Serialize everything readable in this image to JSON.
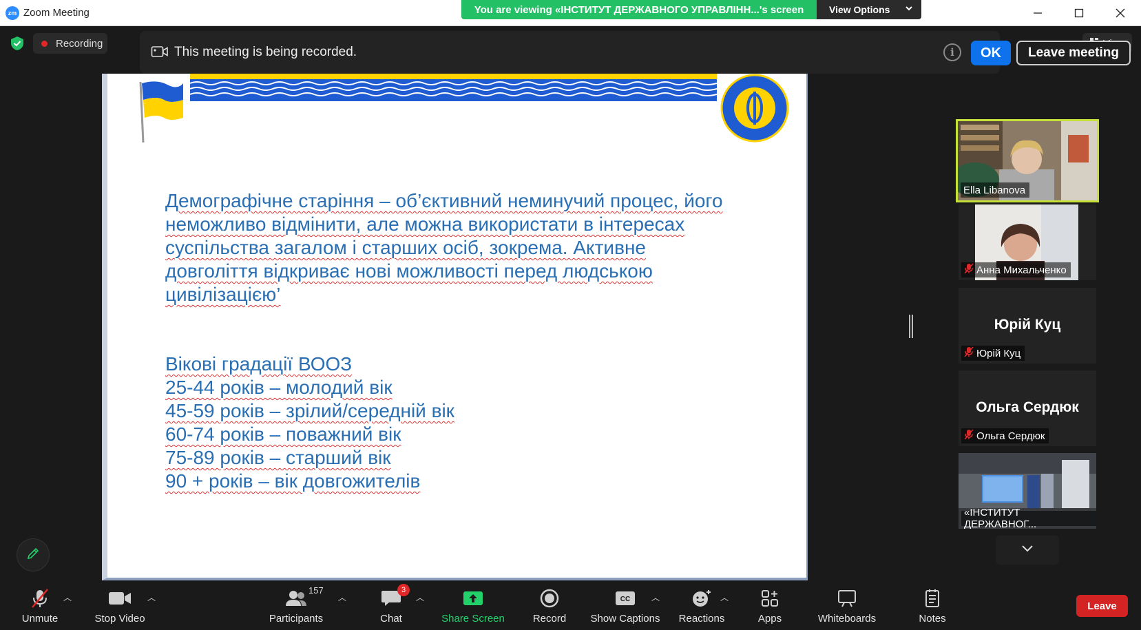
{
  "window": {
    "app_logo": "zm",
    "title": "Zoom Meeting",
    "viewing_banner": "You are viewing «ІНСТИТУТ ДЕРЖАВНОГО УПРАВЛІНН...'s screen",
    "view_options_label": "View Options",
    "controls": [
      "minimize-icon",
      "maximize-icon",
      "close-icon"
    ]
  },
  "meeting_bar": {
    "recording_label": "Recording",
    "view_label": "View"
  },
  "notification": {
    "text": "This meeting is being recorded.",
    "ok_label": "OK",
    "leave_label": "Leave meeting"
  },
  "slide": {
    "paragraph": [
      "Демографічне старіння – об’єктивний неминучий процес, його",
      "неможливо відмінити, але можна використати в інтересах",
      "суспільства загалом і старших осіб, зокрема. Активне",
      "довголіття відкриває нові можливості перед людською",
      "цивілізацією’"
    ],
    "list_title": "Вікові градації ВООЗ",
    "list": [
      "25-44 років – молодий вік",
      "45-59 років – зрілий/середній вік",
      "60-74 років – поважний вік",
      "75-89 років – старший вік",
      "90 + років – вік довгожителів"
    ],
    "colors": {
      "text": "#2a6fb3",
      "flag_blue": "#1f5bd1",
      "flag_yellow": "#ffd200"
    }
  },
  "gallery": [
    {
      "name": "Ella Libanova",
      "active": true,
      "muted": false,
      "video": true
    },
    {
      "name": "Анна Михальченко",
      "active": false,
      "muted": true,
      "video": true
    },
    {
      "name": "Юрій Куц",
      "big_name": "Юрій Куц",
      "active": false,
      "muted": true,
      "video": false
    },
    {
      "name": "Ольга Сердюк",
      "big_name": "Ольга Сердюк",
      "active": false,
      "muted": true,
      "video": false
    },
    {
      "name": "«ІНСТИТУТ ДЕРЖАВНОГ...",
      "active": false,
      "muted": false,
      "video": true
    }
  ],
  "toolbar": {
    "unmute": "Unmute",
    "stop_video": "Stop Video",
    "participants": "Participants",
    "participants_count": "157",
    "chat": "Chat",
    "chat_badge": "3",
    "share_screen": "Share Screen",
    "record": "Record",
    "show_captions": "Show Captions",
    "reactions": "Reactions",
    "apps": "Apps",
    "whiteboards": "Whiteboards",
    "notes": "Notes",
    "leave": "Leave",
    "accent_green": "#23d16a",
    "leave_red": "#d42323"
  }
}
